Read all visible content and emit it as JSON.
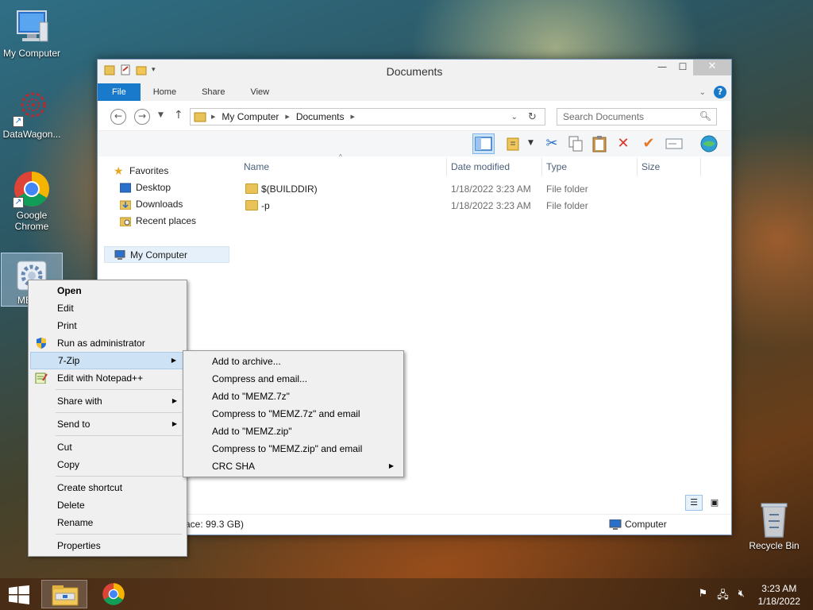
{
  "desktop": {
    "icons": [
      {
        "label": "My Computer"
      },
      {
        "label": "DataWagon..."
      },
      {
        "label": "Google Chrome"
      },
      {
        "label": "ME"
      },
      {
        "label": "Recycle Bin"
      }
    ]
  },
  "window": {
    "title": "Documents",
    "tabs": [
      "File",
      "Home",
      "Share",
      "View"
    ],
    "address": [
      "My Computer",
      "Documents"
    ],
    "search_placeholder": "Search Documents",
    "nav": {
      "favorites": "Favorites",
      "items": [
        "Desktop",
        "Downloads",
        "Recent places"
      ],
      "computer": "My Computer"
    },
    "columns": [
      "Name",
      "Date modified",
      "Type",
      "Size"
    ],
    "rows": [
      {
        "name": "$(BUILDDIR)",
        "date": "1/18/2022 3:23 AM",
        "type": "File folder"
      },
      {
        "name": "-p",
        "date": "1/18/2022 3:23 AM",
        "type": "File folder"
      }
    ],
    "status_left": "ace: 99.3 GB)",
    "status_right": "Computer"
  },
  "context_menu": {
    "items": [
      "Open",
      "Edit",
      "Print",
      "Run as administrator",
      "7-Zip",
      "Edit with Notepad++",
      "Share with",
      "Send to",
      "Cut",
      "Copy",
      "Create shortcut",
      "Delete",
      "Rename",
      "Properties"
    ]
  },
  "submenu_7zip": {
    "items": [
      "Add to archive...",
      "Compress and email...",
      "Add to \"MEMZ.7z\"",
      "Compress to \"MEMZ.7z\" and email",
      "Add to \"MEMZ.zip\"",
      "Compress to \"MEMZ.zip\" and email",
      "CRC SHA"
    ]
  },
  "taskbar": {
    "time": "3:23 AM",
    "date": "1/18/2022"
  },
  "colors": {
    "accent": "#1979ca",
    "highlight": "#cde3f5"
  }
}
